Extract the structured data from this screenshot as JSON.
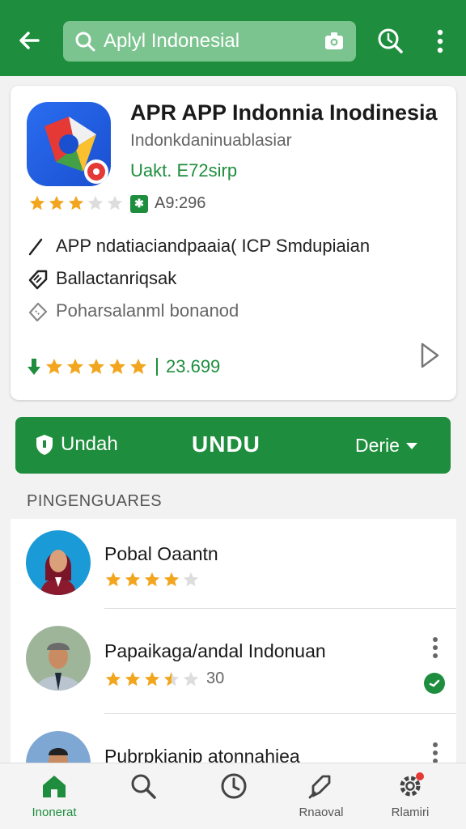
{
  "topbar": {
    "search_text": "Aplyl Indonesial",
    "icons": [
      "back-arrow-icon",
      "search-icon",
      "camera-icon",
      "lens-search-icon",
      "more-vert-icon"
    ]
  },
  "app": {
    "title": "APR APP Indonnia Inodinesia",
    "subtitle": "Indonkdaninuablasiar",
    "price": "Uakt. E72sirp",
    "rating_stars": 3,
    "downloads_badge": "✱",
    "downloads": "A9:296",
    "desc_line_1": "APP ndatiaciandpaaia( ICP Smdupiaian",
    "desc_line_2": "Ballactanriqsak",
    "desc_line_3": "Poharsalanml bonanod",
    "overall_stars": 5,
    "overall_count": "23.699"
  },
  "actions": {
    "left_label": "Undah",
    "center_label": "UNDU",
    "right_label": "Derie"
  },
  "section_label": "PINGENGUARES",
  "reviewers": [
    {
      "name": "Pobal Oaantn",
      "stars": 4,
      "count": ""
    },
    {
      "name": "Papaikaga/andal Indonuan",
      "stars": 3.5,
      "count": "30"
    },
    {
      "name": "Pubrpkianip atonnahiea",
      "stars": 0,
      "count": ""
    }
  ],
  "bottom_nav": [
    {
      "label": "Inonerat",
      "icon": "home-icon",
      "active": true
    },
    {
      "label": "",
      "icon": "search-icon",
      "active": false
    },
    {
      "label": "",
      "icon": "clock-icon",
      "active": false
    },
    {
      "label": "Rnaoval",
      "icon": "rocket-icon",
      "active": false
    },
    {
      "label": "Rlamiri",
      "icon": "settings-icon",
      "active": false
    }
  ],
  "colors": {
    "primary_green": "#1e8e3e",
    "search_bg": "#7cc48f",
    "star": "#f2a61f",
    "star_empty": "#dddddd"
  }
}
